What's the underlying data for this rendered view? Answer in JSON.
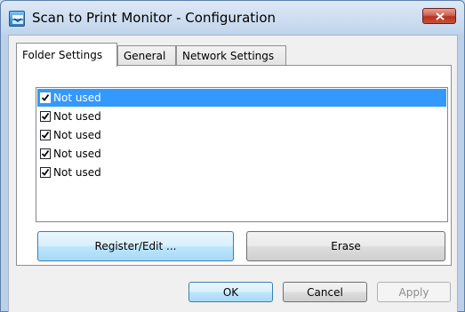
{
  "window": {
    "title": "Scan to Print Monitor - Configuration",
    "icons": {
      "app": "scanner-app-icon",
      "close": "close-icon"
    }
  },
  "tabs": [
    {
      "label": "Folder Settings",
      "active": true
    },
    {
      "label": "General",
      "active": false
    },
    {
      "label": "Network Settings",
      "active": false
    }
  ],
  "folders": {
    "items": [
      {
        "label": "Not used",
        "checked": true,
        "selected": true
      },
      {
        "label": "Not used",
        "checked": true,
        "selected": false
      },
      {
        "label": "Not used",
        "checked": true,
        "selected": false
      },
      {
        "label": "Not used",
        "checked": true,
        "selected": false
      },
      {
        "label": "Not used",
        "checked": true,
        "selected": false
      }
    ],
    "register_label": "Register/Edit ...",
    "erase_label": "Erase"
  },
  "footer": {
    "ok_label": "OK",
    "cancel_label": "Cancel",
    "apply_label": "Apply",
    "apply_enabled": false
  },
  "colors": {
    "selection": "#3399ff",
    "focus_button": "#a7d9f5",
    "close_button": "#c9503c"
  }
}
